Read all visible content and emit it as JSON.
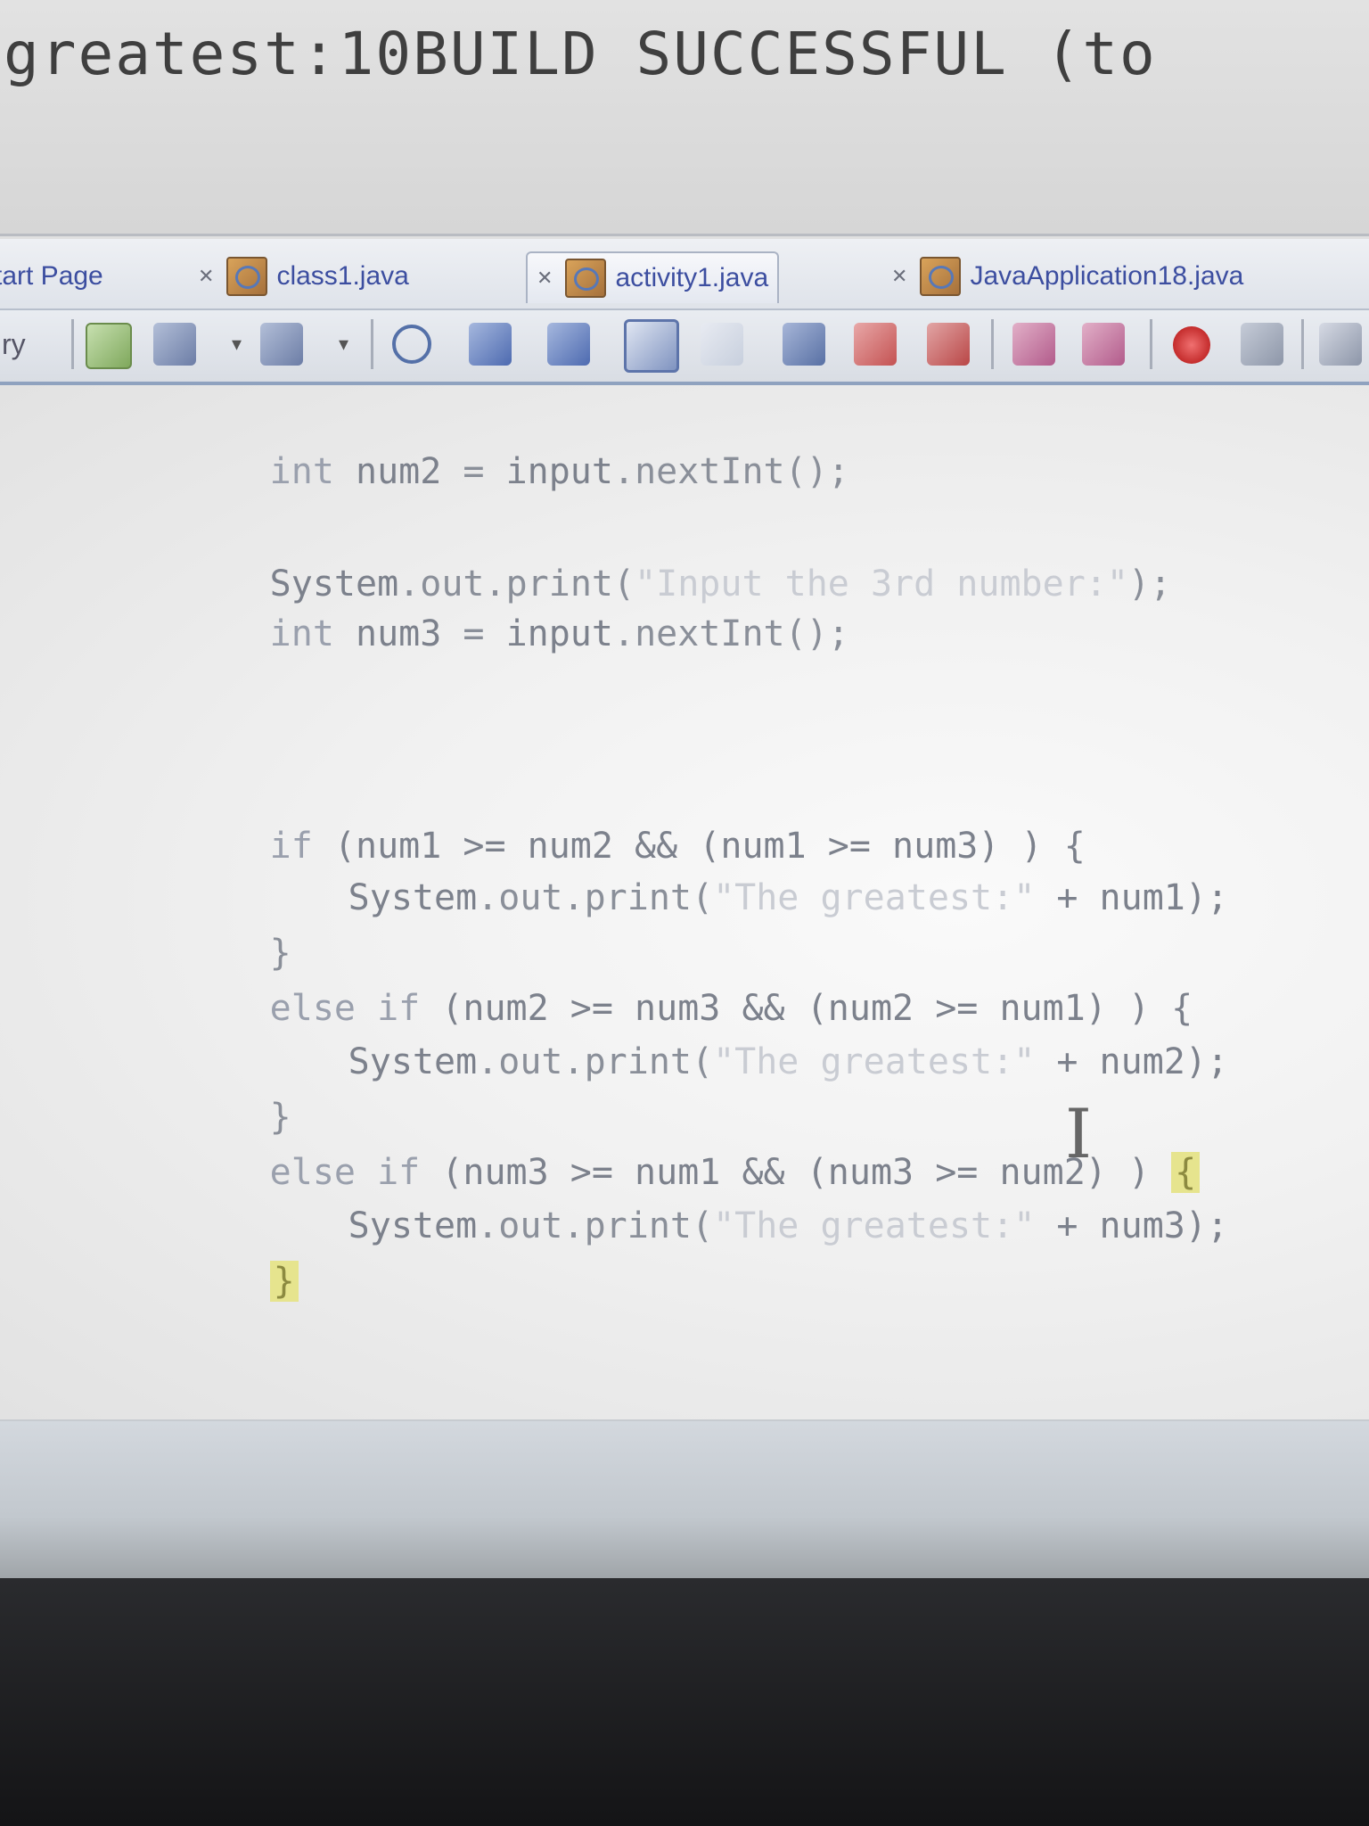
{
  "console": {
    "text": "greatest:10BUILD SUCCESSFUL (to"
  },
  "tabs": [
    {
      "label": "tart Page"
    },
    {
      "label": "class1.java"
    },
    {
      "label": "activity1.java"
    },
    {
      "label": "JavaApplication18.java"
    }
  ],
  "toolbar": {
    "left_label": "ry"
  },
  "code": {
    "l1": [
      "int ",
      "num2",
      " = ",
      "input",
      ".nextInt();"
    ],
    "l2": [
      "System",
      ".out.print(",
      "\"Input the 3rd number:\"",
      ");"
    ],
    "l3": [
      "int ",
      "num3",
      " = ",
      "input",
      ".nextInt();"
    ],
    "if1": [
      "if ",
      "(num1 >= num2 && (num1 >= num3) ) {"
    ],
    "p1": [
      "System",
      ".out.print(",
      "\"The greatest:\"",
      " + num1);"
    ],
    "c1": "}",
    "if2": [
      "else if ",
      "(num2 >= num3 && (num2 >= num1) ) {"
    ],
    "p2": [
      "System",
      ".out.print(",
      "\"The greatest:\"",
      " + num2);"
    ],
    "c2": "}",
    "if3": [
      "else if ",
      "(num3 >= num1 && (num3 >= num2) ) ",
      "{"
    ],
    "p3": [
      "System",
      ".out.print(",
      "\"The greatest:\"",
      " + num3);"
    ],
    "c3": "}"
  },
  "colors": {
    "brace_highlight": "#e6e48e",
    "tab_text": "#3c4ea0"
  }
}
